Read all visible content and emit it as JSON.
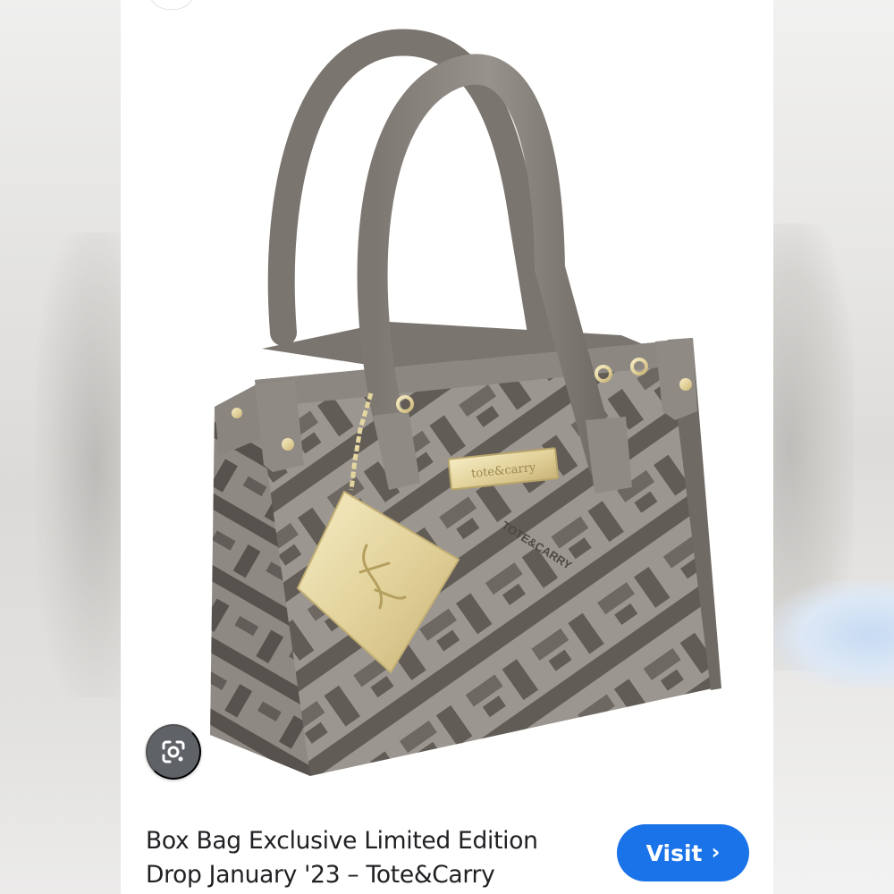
{
  "result": {
    "title_line1": "Box Bag Exclusive Limited Edition",
    "title_line2": "Drop January '23 – Tote&Carry",
    "visit_label": "Visit",
    "visit_icon": "chevron-right-icon",
    "lens_icon": "google-lens-icon"
  },
  "product": {
    "tag_text": "TOTE&CARRY",
    "plate_text": "tote&carry",
    "colors": {
      "bag_base": "#8f8a84",
      "bag_pattern": "#5f5a55",
      "hardware": "#d6c285",
      "accent": "#1a73e8"
    }
  }
}
